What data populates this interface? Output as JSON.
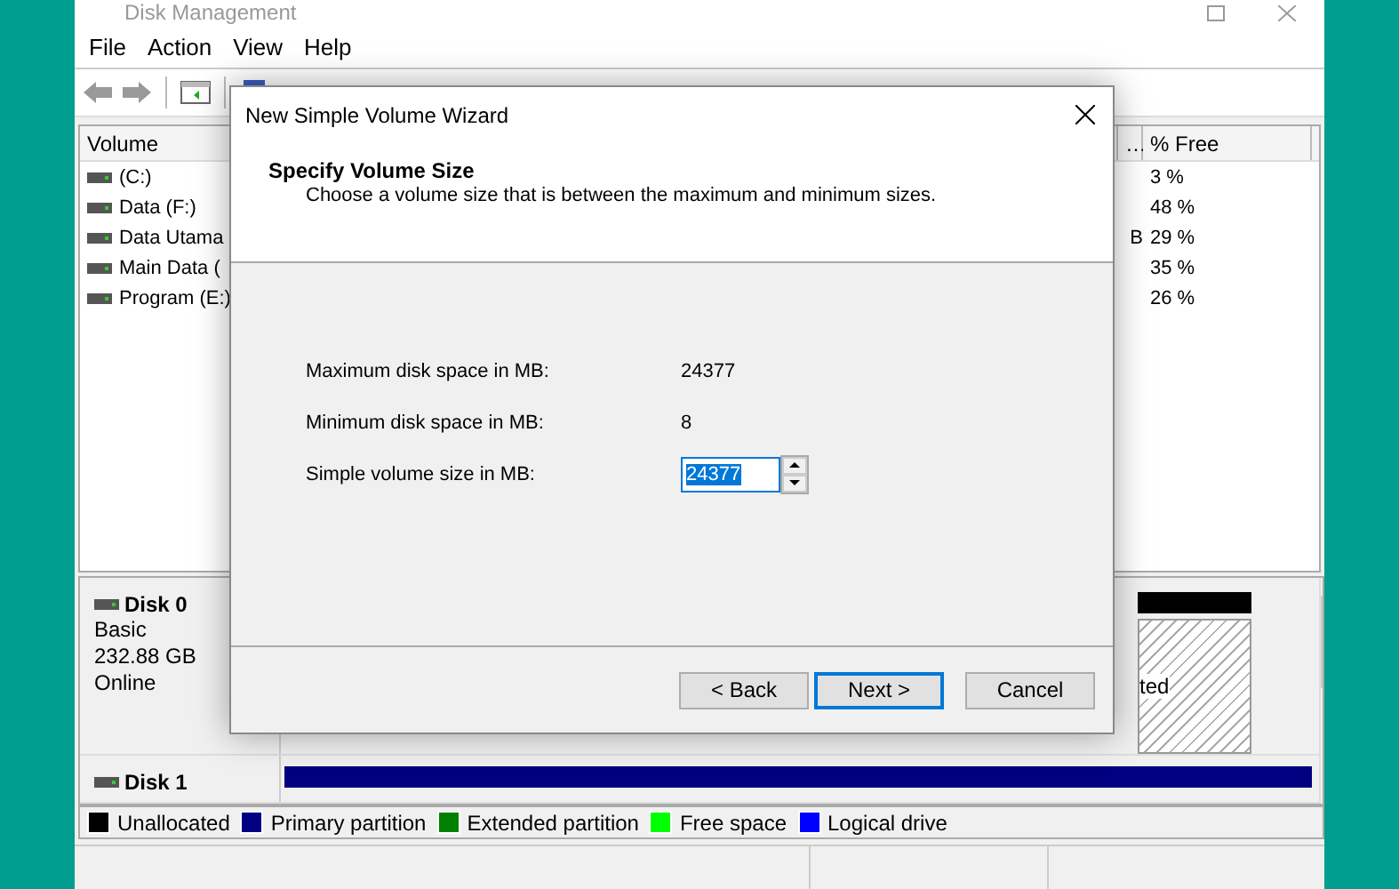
{
  "window": {
    "title": "Disk Management"
  },
  "menu": [
    "File",
    "Action",
    "View",
    "Help"
  ],
  "volume_list": {
    "columns": [
      "Volume",
      "…",
      "% Free"
    ],
    "rows": [
      {
        "volume": "(C:)",
        "free": "3 %"
      },
      {
        "volume": "Data (F:)",
        "free": "48 %"
      },
      {
        "volume": "Data Utama",
        "column_2": "B",
        "free": "29 %"
      },
      {
        "volume": "Main Data (",
        "free": "35 %"
      },
      {
        "volume": "Program (E:)",
        "free": "26 %"
      }
    ]
  },
  "disks": [
    {
      "name": "Disk 0",
      "type": "Basic",
      "size": "232.88 GB",
      "status": "Online",
      "partition_label": "ted"
    },
    {
      "name": "Disk 1"
    }
  ],
  "legend": [
    {
      "label": "Unallocated",
      "color": "#000000"
    },
    {
      "label": "Primary partition",
      "color": "#000080"
    },
    {
      "label": "Extended partition",
      "color": "#008000"
    },
    {
      "label": "Free space",
      "color": "#00ff00"
    },
    {
      "label": "Logical drive",
      "color": "#0000ff"
    }
  ],
  "dialog": {
    "title": "New Simple Volume Wizard",
    "heading": "Specify Volume Size",
    "subtitle": "Choose a volume size that is between the maximum and minimum sizes.",
    "fields": [
      {
        "kind": "text",
        "label": "Maximum disk space in MB:",
        "value": "24377"
      },
      {
        "kind": "text",
        "label": "Minimum disk space in MB:",
        "value": "8"
      },
      {
        "kind": "spinner",
        "label": "Simple volume size in MB:",
        "value": "24377"
      }
    ],
    "buttons": [
      {
        "label": "< Back",
        "focused": false
      },
      {
        "label": "Next >",
        "focused": true
      },
      {
        "label": "Cancel",
        "focused": false
      }
    ]
  }
}
